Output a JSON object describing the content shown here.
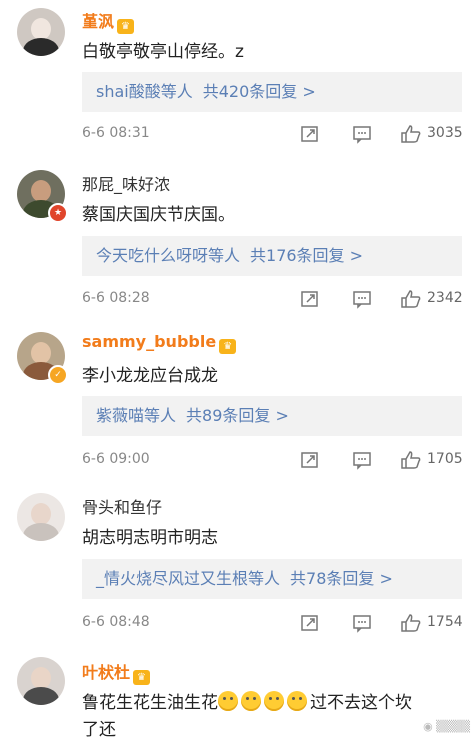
{
  "comments": [
    {
      "username": "堇沨",
      "text": "白敬亭敬亭山停经。z",
      "reply_names": "shai酸酸等人",
      "reply_count": "共420条回复 >",
      "time": "6-6 08:31",
      "likes": "3035"
    },
    {
      "username": "那屁_味好浓",
      "text": "蔡国庆国庆节庆国。",
      "reply_names": "今天吃什么呀呀等人",
      "reply_count": "共176条回复 >",
      "time": "6-6 08:28",
      "likes": "2342"
    },
    {
      "username": "sammy_bubble",
      "text": "李小龙龙应台成龙",
      "reply_names": "紫薇喵等人",
      "reply_count": "共89条回复 >",
      "time": "6-6 09:00",
      "likes": "1705"
    },
    {
      "username": "骨头和鱼仔",
      "text": "胡志明志明市明志",
      "reply_names": "_情火烧尽风过又生根等人",
      "reply_count": "共78条回复 >",
      "time": "6-6 08:48",
      "likes": "1754"
    },
    {
      "username": "叶枤杜",
      "text_line1_a": "鲁花生花生油生花",
      "text_line1_b": "过不去这个坎",
      "text_line2": "了还"
    }
  ],
  "icons": {
    "repost": "repost-icon",
    "comment": "comment-icon",
    "like": "like-icon",
    "crown": "member-crown-icon",
    "emoji": "laugh-cry-emoji-icon"
  },
  "colors": {
    "vip_name": "#f27c1b",
    "link": "#5b7fb5",
    "reply_bg": "#f2f2f2",
    "meta": "#888888"
  }
}
